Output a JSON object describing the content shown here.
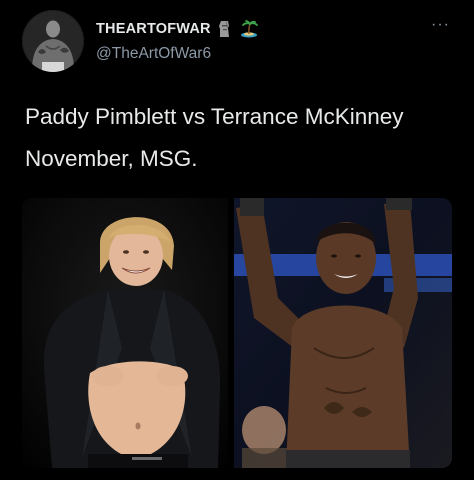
{
  "author": {
    "display_name": "THEARTOFWAR",
    "handle": "@TheArtOfWar6",
    "emojis": [
      "moai-icon",
      "desert-island-icon"
    ]
  },
  "menu": {
    "more_label": "···"
  },
  "tweet": {
    "lines": [
      "Paddy Pimblett vs Terrance McKinney",
      "November, MSG."
    ]
  },
  "media": {
    "photos": [
      "fighter-photo-left",
      "fighter-photo-right"
    ]
  },
  "colors": {
    "background": "#000000",
    "text": "#e7e9ea",
    "secondary": "#8b98a5"
  }
}
